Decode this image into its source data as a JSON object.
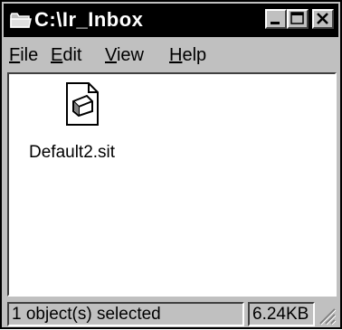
{
  "window": {
    "title": "C:\\Ir_Inbox",
    "icons": {
      "title": "folder-icon",
      "minimize": "minimize-icon",
      "maximize": "maximize-icon",
      "close": "close-icon",
      "file": "document-icon",
      "grip": "resize-grip-icon"
    }
  },
  "menu": {
    "items": [
      {
        "accel": "F",
        "rest": "ile"
      },
      {
        "accel": "E",
        "rest": "dit"
      },
      {
        "accel": "V",
        "rest": "iew"
      },
      {
        "accel": "H",
        "rest": "elp"
      }
    ]
  },
  "content": {
    "files": [
      {
        "name": "Default2.sit"
      }
    ]
  },
  "status": {
    "selection": "1 object(s) selected",
    "size": "6.24KB"
  },
  "colors": {
    "titlebar_bg": "#000000",
    "face": "#c0c0c0",
    "content_bg": "#ffffff"
  }
}
